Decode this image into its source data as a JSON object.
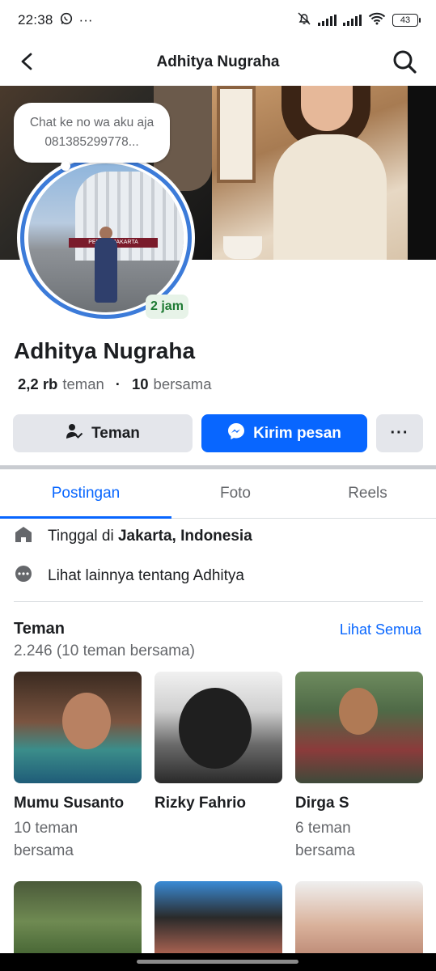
{
  "status_bar": {
    "time": "22:38",
    "more": "···",
    "battery": "43"
  },
  "header": {
    "title": "Adhitya Nugraha"
  },
  "profile": {
    "note": "Chat ke no wa aku aja 081385299778...",
    "note_age": "2 jam",
    "name": "Adhitya Nugraha",
    "friends_count": "2,2 rb",
    "friends_label": "teman",
    "mutual_count": "10",
    "mutual_label": "bersama",
    "separator": "·",
    "avatar_banner": "PERSIJA JAKARTA"
  },
  "actions": {
    "friend_label": "Teman",
    "message_label": "Kirim pesan",
    "more_label": "···"
  },
  "tabs": [
    {
      "label": "Postingan",
      "active": true
    },
    {
      "label": "Foto",
      "active": false
    },
    {
      "label": "Reels",
      "active": false
    }
  ],
  "about": {
    "lives_prefix": "Tinggal di",
    "lives_city": "Jakarta, Indonesia",
    "more_about": "Lihat lainnya tentang Adhitya"
  },
  "friends": {
    "title": "Teman",
    "see_all": "Lihat Semua",
    "subtitle": "2.246 (10 teman bersama)",
    "items": [
      {
        "name": "Mumu Susanto",
        "mutual": "10 teman bersama"
      },
      {
        "name": "Rizky Fahrio",
        "mutual": ""
      },
      {
        "name": "Dirga S",
        "mutual": "6 teman bersama"
      }
    ]
  },
  "colors": {
    "accent": "#0866ff",
    "ring": "#3c7bd9",
    "badge_green": "#1e7a33",
    "muted": "#65676b"
  }
}
